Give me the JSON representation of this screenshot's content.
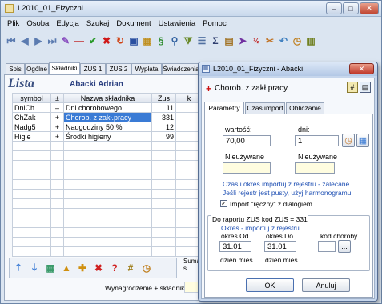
{
  "main": {
    "title": "L2010_01_Fizyczni",
    "menu": [
      "Plik",
      "Osoba",
      "Edycja",
      "Szukaj",
      "Dokument",
      "Ustawienia",
      "Pomoc"
    ],
    "tabs": [
      "Spis",
      "Ogólne",
      "Składniki",
      "ZUS 1",
      "ZUS 2",
      "Wypłata",
      "Świadczenia"
    ],
    "heading": "Lista",
    "person": "Abacki Adrian",
    "columns": [
      "symbol",
      "±",
      "Nazwa składnika",
      "Zus",
      "k"
    ],
    "rows": [
      {
        "symbol": "DniCh",
        "sign": "–",
        "name": "Dni chorobowego",
        "zus": "11"
      },
      {
        "symbol": "ChZak",
        "sign": "+",
        "name": "Chorob. z zakł.pracy",
        "zus": "331"
      },
      {
        "symbol": "Nadg5",
        "sign": "+",
        "name": "Nadgodziny 50 %",
        "zus": "12"
      },
      {
        "symbol": "Higie",
        "sign": "+",
        "name": "Środki higieny",
        "zus": "99"
      }
    ],
    "suma_label": "Suma s",
    "wynagrodzenie_label": "Wynagrodzenie + składniki"
  },
  "dialog": {
    "title": "L2010_01_Fizyczni  -  Abacki",
    "heading": "Chorob. z zakł.pracy",
    "tabs": [
      "Parametry",
      "Czas import",
      "Obliczanie"
    ],
    "wartosc_label": "wartość:",
    "wartosc_value": "70,00",
    "dni_label": "dni:",
    "dni_value": "1",
    "unused1": "Nieużywane",
    "unused2": "Nieużywane",
    "info1": "Czas i okres importuj z rejestru - zalecane",
    "info2": "Jeśli rejestr jest pusty, użyj  harmonogramu",
    "checkbox_label": "Import \"ręczny\" z dialogiem",
    "zus_header": "Do raportu ZUS   kod ZUS = 331",
    "okresy_note": "Okres - importuj z rejestru",
    "okres_od_label": "okres  Od",
    "okres_do_label": "okres  Do",
    "kod_choroby_label": "kod choroby",
    "okres_od_value": "31.01",
    "okres_do_value": "31.01",
    "dzien_mies_1": "dzień.mies.",
    "dzien_mies_2": "dzień.mies.",
    "ok_label": "OK",
    "cancel_label": "Anuluj",
    "ellipsis": "..."
  },
  "colors": {
    "accent_red": "#cc1111",
    "link_blue": "#1e4fb3",
    "selection_blue": "#3a7bd5"
  }
}
